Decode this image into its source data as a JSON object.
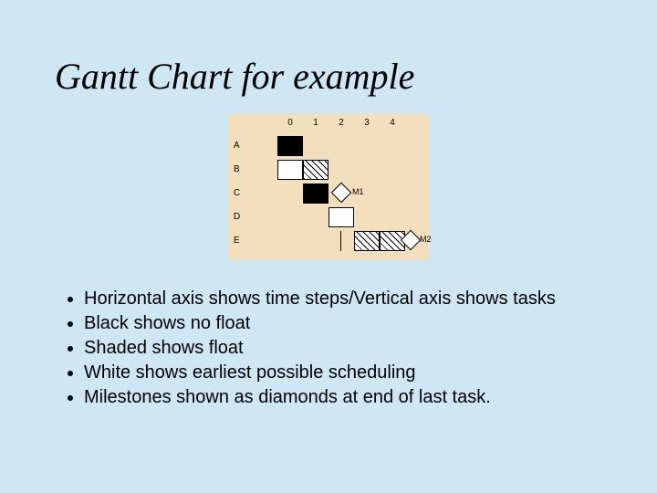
{
  "title": "Gantt Chart for example",
  "chart_data": {
    "type": "table",
    "title": "Gantt Chart",
    "time_steps": [
      "0",
      "1",
      "2",
      "3",
      "4"
    ],
    "tasks": [
      "A",
      "B",
      "C",
      "D",
      "E"
    ],
    "cells": {
      "A": [
        {
          "t": 0,
          "kind": "black"
        }
      ],
      "B": [
        {
          "t": 0,
          "kind": "white"
        },
        {
          "t": 1,
          "kind": "hatch"
        }
      ],
      "C": [
        {
          "t": 1,
          "kind": "black"
        }
      ],
      "D": [
        {
          "t": 2,
          "kind": "white"
        }
      ],
      "E": [
        {
          "t": 3,
          "kind": "hatch"
        },
        {
          "t": 4,
          "kind": "hatch"
        }
      ]
    },
    "milestones": [
      {
        "name": "M1",
        "after_task": "C",
        "t": 2
      },
      {
        "name": "M2",
        "after_task": "E",
        "t": 5
      }
    ],
    "legend": {
      "black": "no float",
      "hatch": "float",
      "white": "earliest possible scheduling",
      "diamond": "milestone"
    }
  },
  "bullets": [
    "Horizontal axis shows time steps/Vertical axis shows tasks",
    "Black shows no float",
    "Shaded shows float",
    "White shows earliest possible scheduling",
    "Milestones shown as diamonds at end of last task."
  ],
  "ms1_label": "M1",
  "ms2_label": "M2"
}
